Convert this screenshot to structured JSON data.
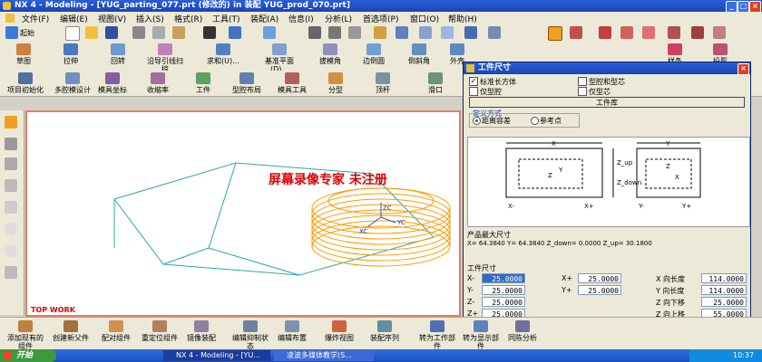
{
  "window": {
    "title": "NX 4 - Modeling - [YUG_parting_077.prt  (修改的)    in 装配 YUG_prod_070.prt]",
    "controls": {
      "minimize": "_",
      "maximize": "□",
      "close": "×"
    }
  },
  "menu": [
    "文件(F)",
    "编辑(E)",
    "视图(V)",
    "插入(S)",
    "格式(R)",
    "工具(T)",
    "装配(A)",
    "信息(I)",
    "分析(L)",
    "首选项(P)",
    "窗口(O)",
    "帮助(H)"
  ],
  "toolbar_start_label": "起始",
  "toolbar2": [
    "草图",
    "拉伸",
    "回转",
    "沿导引线扫掠",
    "求和(U)...",
    "基准平面(D)...",
    "拔模角",
    "边倒圆",
    "倒斜角",
    "外壳",
    "孔",
    "特征",
    "样条",
    "投影"
  ],
  "toolbar3": [
    "项目初始化",
    "多腔模设计",
    "模具坐标",
    "收缩率",
    "工件",
    "型腔布局",
    "模具工具",
    "分型",
    "顶杆",
    "滑口"
  ],
  "viewport": {
    "watermark": "屏幕录像专家  未注册",
    "view_label": "TOP WORK",
    "axis_labels": [
      "ZC",
      "YC",
      "XC"
    ]
  },
  "dialog": {
    "title": "工件尺寸",
    "close": "×",
    "types": [
      {
        "label": "标准长方体",
        "checked": true
      },
      {
        "label": "型腔和型芯",
        "checked": false
      },
      {
        "label": "仅型腔",
        "checked": false
      },
      {
        "label": "仅型芯",
        "checked": false
      }
    ],
    "library_button": "工件库",
    "define_method": {
      "group": "定义方式",
      "options": [
        {
          "label": "距离容差",
          "selected": true
        },
        {
          "label": "参考点",
          "selected": false
        }
      ]
    },
    "diagram_labels": [
      "X",
      "X-",
      "X+",
      "Y",
      "Y-",
      "Y+",
      "Z_up",
      "Z_down",
      "Z",
      "Y",
      "Z",
      "X"
    ],
    "max_size": {
      "heading": "产品最大尺寸",
      "text": "X= 64.3840  Y= 64.3840  Z_down= 0.0000  Z_up= 30.1800"
    },
    "size_heading": "工件尺寸",
    "fields": {
      "x_minus": {
        "label": "X-",
        "value": "25.0000"
      },
      "y_minus": {
        "label": "Y-",
        "value": "25.0000"
      },
      "z_minus": {
        "label": "Z-",
        "value": "25.0000"
      },
      "z_plus": {
        "label": "Z+",
        "value": "25.0000"
      },
      "x_plus": {
        "label": "X+",
        "value": "25.0000"
      },
      "y_plus": {
        "label": "Y+",
        "value": "25.0000"
      },
      "x_len": {
        "label": "X 向长度",
        "value": "114.0000"
      },
      "y_len": {
        "label": "Y 向长度",
        "value": "114.0000"
      },
      "z_down": {
        "label": "Z 向下移",
        "value": "25.0000"
      },
      "z_up": {
        "label": "Z 向上移",
        "value": "55.0000"
      }
    },
    "buttons": {
      "ok": "确定",
      "apply": "应用",
      "cancel": "取消"
    }
  },
  "bottom_toolbar": [
    "添加现有的组件",
    "创建新父件",
    "配对组件",
    "重定位组件",
    "镜像装配",
    "编辑抑制状态",
    "编辑布置",
    "爆炸视图",
    "装配序列",
    "转为工作部件",
    "转为显示部件",
    "同陈分析"
  ],
  "taskbar": {
    "start": "开始",
    "tasks": [
      "NX 4 - Modeling - [YU...",
      "凌波多媒体教学(S..."
    ],
    "clock": "10:37"
  }
}
